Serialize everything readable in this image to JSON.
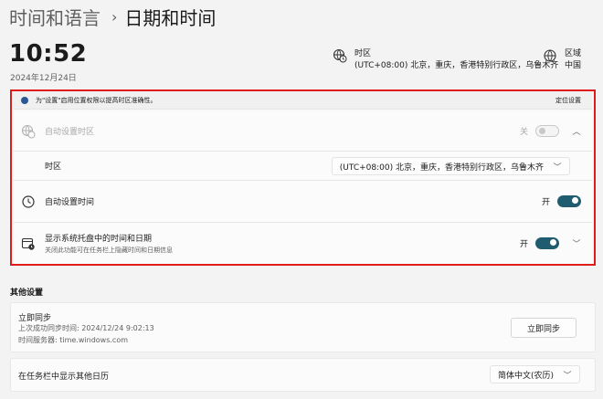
{
  "breadcrumb": {
    "parent": "时间和语言",
    "separator": "›",
    "current": "日期和时间"
  },
  "clock": {
    "time": "10:52",
    "date": "2024年12月24日"
  },
  "timezone_summary": {
    "label": "时区",
    "value": "(UTC+08:00) 北京，重庆，香港特别行政区，乌鲁木齐"
  },
  "region_summary": {
    "label": "区域",
    "value": "中国"
  },
  "notice": {
    "text": "为\"设置\"启用位置权限以提高时区准确性。",
    "link": "定位设置"
  },
  "auto_timezone": {
    "label": "自动设置时区",
    "state": "关"
  },
  "timezone_row": {
    "label": "时区",
    "value": "(UTC+08:00) 北京，重庆，香港特别行政区，乌鲁木齐"
  },
  "auto_time": {
    "label": "自动设置时间",
    "state": "开"
  },
  "tray": {
    "label": "显示系统托盘中的时间和日期",
    "desc": "关闭此功能可在任务栏上隐藏时间和日期信息",
    "state": "开"
  },
  "other": {
    "title": "其他设置",
    "sync": {
      "title": "立即同步",
      "last": "上次成功同步时间: 2024/12/24 9:02:13",
      "server": "时间服务器: time.windows.com",
      "button": "立即同步"
    },
    "calendar": {
      "label": "在任务栏中显示其他日历",
      "value": "简体中文(农历)"
    }
  },
  "colors": {
    "accent": "#1f5c70",
    "highlight_border": "#e01b1b"
  }
}
